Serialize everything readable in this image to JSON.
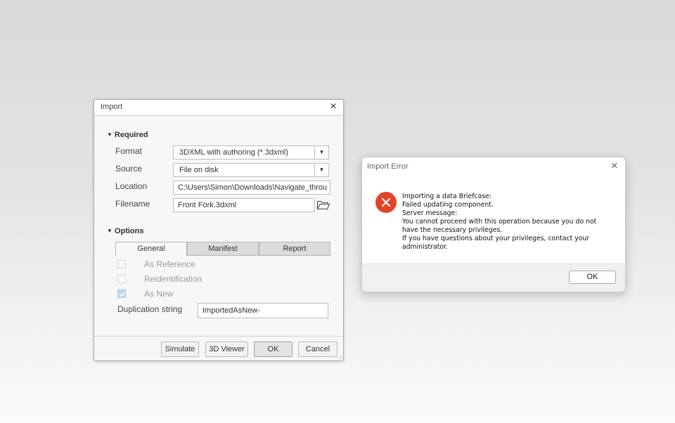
{
  "import_dialog": {
    "title": "Import",
    "close_symbol": "×",
    "required": {
      "header": "Required",
      "format_label": "Format",
      "format_value": "3DXML with authoring (*.3dxml)",
      "source_label": "Source",
      "source_value": "File on disk",
      "location_label": "Location",
      "location_value": "C:\\Users\\Simon\\Downloads\\Navigate_throu",
      "filename_label": "Filename",
      "filename_value": "Front Fork.3dxml"
    },
    "options": {
      "header": "Options",
      "tabs": [
        "General",
        "Manifest",
        "Report"
      ],
      "as_reference_label": "As Reference",
      "as_reference_checked": false,
      "reidentification_label": "Reidentification",
      "reidentification_checked": false,
      "as_new_label": "As New",
      "as_new_checked": true,
      "duplication_label": "Duplication string",
      "duplication_value": "ImportedAsNew-"
    },
    "buttons": {
      "simulate": "Simulate",
      "viewer": "3D Viewer",
      "ok": "OK",
      "cancel": "Cancel"
    }
  },
  "error_dialog": {
    "title": "Import Error",
    "close_symbol": "×",
    "icon": "error-x-icon",
    "icon_color": "#e0452b",
    "message_lines": [
      "Importing a data Briefcase:",
      "Failed updating component.",
      "Server message:",
      "You cannot proceed with this operation because you do not",
      "have the necessary privileges.",
      "If you have questions about your privileges, contact your",
      "administrator."
    ],
    "ok_label": "OK"
  }
}
